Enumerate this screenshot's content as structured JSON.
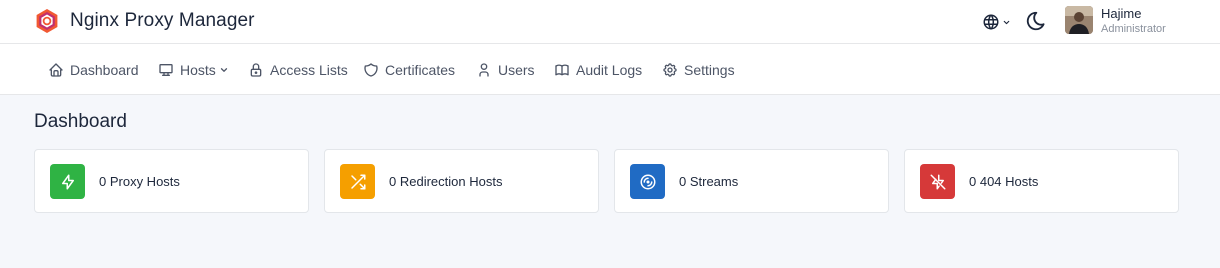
{
  "app": {
    "title": "Nginx Proxy Manager",
    "logo_icon": "npm-hexagon-logo-icon",
    "accent_color": "#e8541f"
  },
  "header": {
    "language_icon": "globe-icon",
    "theme_icon": "moon-icon",
    "user": {
      "name": "Hajime",
      "role": "Administrator",
      "avatar_icon": "user-avatar"
    }
  },
  "nav": {
    "items": [
      {
        "label": "Dashboard",
        "icon": "home-icon"
      },
      {
        "label": "Hosts",
        "icon": "monitor-icon",
        "has_dropdown": true
      },
      {
        "label": "Access Lists",
        "icon": "lock-icon"
      },
      {
        "label": "Certificates",
        "icon": "shield-icon"
      },
      {
        "label": "Users",
        "icon": "user-icon"
      },
      {
        "label": "Audit Logs",
        "icon": "book-icon"
      },
      {
        "label": "Settings",
        "icon": "gear-icon"
      }
    ]
  },
  "main": {
    "title": "Dashboard",
    "cards": [
      {
        "label": "0 Proxy Hosts",
        "icon": "bolt-icon",
        "color": "#2fb344"
      },
      {
        "label": "0 Redirection Hosts",
        "icon": "shuffle-icon",
        "color": "#f59f00"
      },
      {
        "label": "0 Streams",
        "icon": "disc-icon",
        "color": "#206bc4"
      },
      {
        "label": "0 404 Hosts",
        "icon": "bolt-off-icon",
        "color": "#d63939"
      }
    ]
  }
}
